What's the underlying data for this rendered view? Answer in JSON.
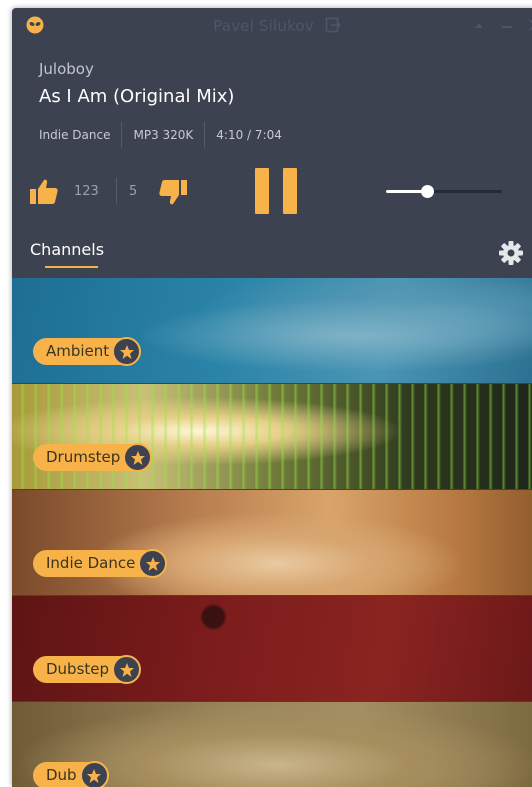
{
  "window": {
    "title": "Pavel Silukov",
    "icons": [
      "alien-logo-icon",
      "logout-icon",
      "collapse-icon",
      "minimize-icon",
      "close-icon"
    ]
  },
  "now_playing": {
    "artist": "Juloboy",
    "title": "As I Am (Original Mix)",
    "genre": "Indie Dance",
    "format": "MP3 320K",
    "time": "4:10 / 7:04"
  },
  "controls": {
    "likes": "123",
    "dislikes": "5",
    "volume_level": 0.35,
    "state": "playing",
    "icons": [
      "thumbs-up-icon",
      "thumbs-down-icon",
      "pause-icon",
      "volume-slider"
    ]
  },
  "tabs": {
    "channels_label": "Channels",
    "settings_icon": "gear-icon"
  },
  "channels": [
    {
      "name": "Ambient"
    },
    {
      "name": "Drumstep"
    },
    {
      "name": "Indie Dance"
    },
    {
      "name": "Dubstep"
    },
    {
      "name": "Dub"
    }
  ],
  "colors": {
    "accent": "#f8b24a",
    "panel": "#3d4250",
    "text_primary": "#ffffff",
    "text_muted": "#9ba0ad"
  }
}
